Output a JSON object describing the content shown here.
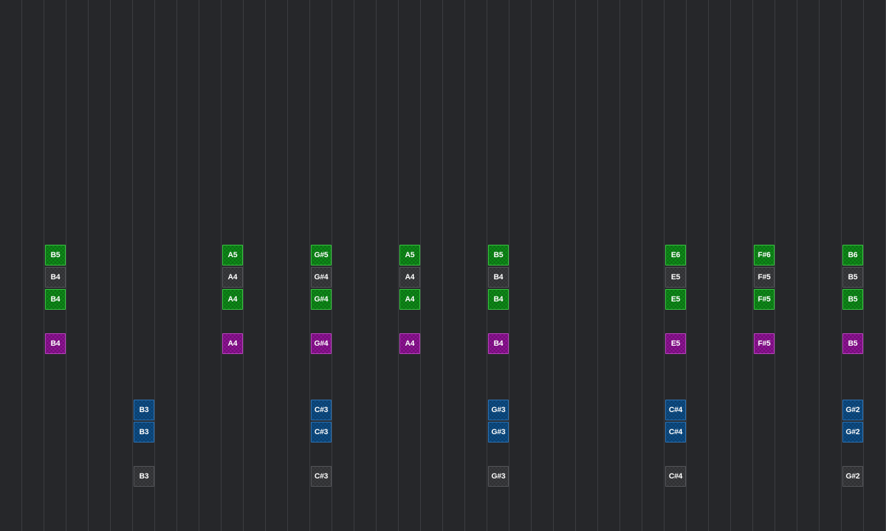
{
  "colors": {
    "background": "#26272a",
    "grid_line": "#3d3e42",
    "green": "#0e8a18",
    "gray": "#3a3b3e",
    "purple": "#8e1294",
    "blue": "#0d4d86"
  },
  "note_columns": [
    {
      "notes": [
        {
          "label": "B5",
          "color": "green"
        },
        {
          "label": "B4",
          "color": "gray"
        },
        {
          "label": "B4",
          "color": "green"
        },
        {
          "label": "B4",
          "color": "purple"
        }
      ]
    },
    {
      "notes": [
        {
          "label": "B3",
          "color": "blue"
        },
        {
          "label": "B3",
          "color": "blue"
        },
        {
          "label": "B3",
          "color": "gray"
        }
      ]
    },
    {
      "notes": [
        {
          "label": "A5",
          "color": "green"
        },
        {
          "label": "A4",
          "color": "gray"
        },
        {
          "label": "A4",
          "color": "green"
        },
        {
          "label": "A4",
          "color": "purple"
        }
      ]
    },
    {
      "notes": [
        {
          "label": "G#5",
          "color": "green"
        },
        {
          "label": "G#4",
          "color": "gray"
        },
        {
          "label": "G#4",
          "color": "green"
        },
        {
          "label": "G#4",
          "color": "purple"
        },
        {
          "label": "C#3",
          "color": "blue"
        },
        {
          "label": "C#3",
          "color": "blue"
        },
        {
          "label": "C#3",
          "color": "gray"
        }
      ]
    },
    {
      "notes": [
        {
          "label": "A5",
          "color": "green"
        },
        {
          "label": "A4",
          "color": "gray"
        },
        {
          "label": "A4",
          "color": "green"
        },
        {
          "label": "A4",
          "color": "purple"
        }
      ]
    },
    {
      "notes": [
        {
          "label": "B5",
          "color": "green"
        },
        {
          "label": "B4",
          "color": "gray"
        },
        {
          "label": "B4",
          "color": "green"
        },
        {
          "label": "B4",
          "color": "purple"
        },
        {
          "label": "G#3",
          "color": "blue"
        },
        {
          "label": "G#3",
          "color": "blue"
        },
        {
          "label": "G#3",
          "color": "gray"
        }
      ]
    },
    {
      "notes": [
        {
          "label": "E6",
          "color": "green"
        },
        {
          "label": "E5",
          "color": "gray"
        },
        {
          "label": "E5",
          "color": "green"
        },
        {
          "label": "E5",
          "color": "purple"
        },
        {
          "label": "C#4",
          "color": "blue"
        },
        {
          "label": "C#4",
          "color": "blue"
        },
        {
          "label": "C#4",
          "color": "gray"
        }
      ]
    },
    {
      "notes": [
        {
          "label": "F#6",
          "color": "green"
        },
        {
          "label": "F#5",
          "color": "gray"
        },
        {
          "label": "F#5",
          "color": "green"
        },
        {
          "label": "F#5",
          "color": "purple"
        }
      ]
    },
    {
      "notes": [
        {
          "label": "B6",
          "color": "green"
        },
        {
          "label": "B5",
          "color": "gray"
        },
        {
          "label": "B5",
          "color": "green"
        },
        {
          "label": "B5",
          "color": "purple"
        },
        {
          "label": "G#2",
          "color": "blue"
        },
        {
          "label": "G#2",
          "color": "blue"
        },
        {
          "label": "G#2",
          "color": "gray"
        }
      ]
    }
  ]
}
